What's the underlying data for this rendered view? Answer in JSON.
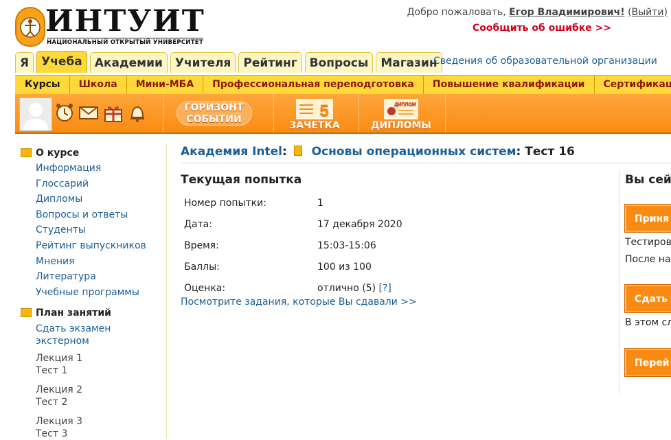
{
  "header": {
    "logo_title": "ИНТУИТ",
    "logo_subtitle": "НАЦИОНАЛЬНЫЙ ОТКРЫТЫЙ УНИВЕРСИТЕТ",
    "welcome_prefix": "Добро пожаловать,",
    "user_name": "Егор Владимирович!",
    "logout_label": "(Выйти)",
    "report_error": "Сообщить об ошибке >>"
  },
  "tabs": [
    {
      "label": "Я",
      "active": false
    },
    {
      "label": "Учеба",
      "active": true
    },
    {
      "label": "Академии",
      "active": false
    },
    {
      "label": "Учителя",
      "active": false
    },
    {
      "label": "Рейтинг",
      "active": false
    },
    {
      "label": "Вопросы",
      "active": false
    },
    {
      "label": "Магазин",
      "active": false
    }
  ],
  "org_link": "Сведения об образовательной организации",
  "subnav": [
    "Курсы",
    "Школа",
    "Мини-МБА",
    "Профессиональная переподготовка",
    "Повышение квалификации",
    "Сертификация"
  ],
  "toolbar": {
    "horizon_line1": "ГОРИЗОНТ",
    "horizon_line2": "СОБЫТИЙ",
    "zachetka_number": "5",
    "zachetka": "ЗАЧЕТКА",
    "diploma_badge": "ДИПЛОМ",
    "diplomy": "ДИПЛОМЫ",
    "icons": [
      "alarm-clock-icon",
      "mail-icon",
      "gift-icon",
      "bell-icon"
    ]
  },
  "sidebar": {
    "about_title": "О курсе",
    "about_links": [
      "Информация",
      "Глоссарий",
      "Дипломы",
      "Вопросы и ответы",
      "Студенты",
      "Рейтинг выпускников",
      "Мнения",
      "Литература",
      "Учебные программы"
    ],
    "plan_title": "План занятий",
    "plan_link_1": "Сдать экзамен",
    "plan_link_2": "экстерном",
    "lessons": [
      {
        "lecture": "Лекция 1",
        "test": "Тест 1"
      },
      {
        "lecture": "Лекция 2",
        "test": "Тест 2"
      },
      {
        "lecture": "Лекция 3",
        "test": "Тест 3"
      }
    ]
  },
  "breadcrumb": {
    "academy": "Академия Intel",
    "course": "Основы операционных систем",
    "current": "Тест 16"
  },
  "attempt": {
    "title": "Текущая попытка",
    "rows": [
      {
        "label": "Номер попытки:",
        "value": "1"
      },
      {
        "label": "Дата:",
        "value": "17 декабря 2020"
      },
      {
        "label": "Время:",
        "value": "15:03-15:06"
      },
      {
        "label": "Баллы:",
        "value": "100 из 100"
      },
      {
        "label": "Оценка:",
        "value": "отлично (5)"
      }
    ],
    "help_link": "[?]",
    "view_link": "Посмотрите задания, которые Вы сдавали >>"
  },
  "right_panel": {
    "title": "Вы сейч",
    "button1": "Приня",
    "text1": "Тестирова",
    "text2": "После наж",
    "button2": "Сдать т",
    "text3": "В этом слу",
    "button3": "Перей"
  },
  "colors": {
    "accent_yellow": "#ffd93a",
    "accent_orange": "#f98b13",
    "link_blue": "#1b5e96",
    "error_red": "#d0021b"
  }
}
